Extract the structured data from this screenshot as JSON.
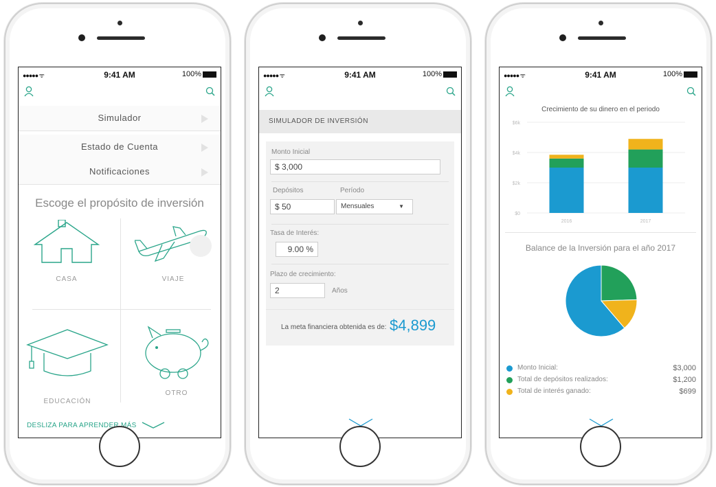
{
  "status": {
    "carrier": "●●●●● ᯤ",
    "time": "9:41 AM",
    "battery": "100%"
  },
  "screen1": {
    "menu": [
      {
        "label": "Simulador"
      },
      {
        "label": "Estado de Cuenta"
      },
      {
        "label": "Notificaciones"
      }
    ],
    "purpose_title": "Escoge el propósito de inversión",
    "options": [
      {
        "label": "CASA",
        "icon": "house-icon"
      },
      {
        "label": "VIAJE",
        "icon": "airplane-icon"
      },
      {
        "label": "EDUCACIÓN",
        "icon": "graduation-cap-icon"
      },
      {
        "label": "OTRO",
        "icon": "piggy-bank-icon"
      }
    ],
    "swipe_label": "DESLIZA PARA APRENDER MÁS"
  },
  "screen2": {
    "header": "SIMULADOR DE INVERSIÓN",
    "monto_label": "Monto Inicial",
    "monto_value": "$  3,000",
    "depositos_label": "Depósitos",
    "depositos_value": "$  50",
    "periodo_label": "Período",
    "periodo_value": "Mensuales",
    "tasa_label": "Tasa de Interés:",
    "tasa_value": "9.00  %",
    "plazo_label": "Plazo de crecimiento:",
    "plazo_value": "2",
    "plazo_unit": "Años",
    "result_label": "La meta financiera obtenida es de:",
    "result_value": "$4,899"
  },
  "screen3": {
    "legend": [
      {
        "name": "Monto Inicial:",
        "value": "$3,000",
        "color": "#1b9ad0"
      },
      {
        "name": "Total de depósitos realizados:",
        "value": "$1,200",
        "color": "#22a05a"
      },
      {
        "name": "Total de interés ganado:",
        "value": "$699",
        "color": "#f0b31c"
      }
    ]
  },
  "chart_data": [
    {
      "type": "bar",
      "stacked": true,
      "title": "Crecimiento de su dinero en el periodo",
      "categories": [
        "2016",
        "2017"
      ],
      "ytick_labels": [
        "$0",
        "$2k",
        "$4k",
        "$6k"
      ],
      "ylim": [
        0,
        6000
      ],
      "series": [
        {
          "values": [
            3000,
            3000
          ],
          "color": "#1b9ad0"
        },
        {
          "values": [
            600,
            1200
          ],
          "color": "#22a05a"
        },
        {
          "values": [
            250,
            699
          ],
          "color": "#f0b31c"
        }
      ]
    },
    {
      "type": "pie",
      "title": "Balance de la Inversión para el año 2017",
      "labels": [
        "Monto Inicial:",
        "Total de depósitos realizados:",
        "Total de interés ganado:"
      ],
      "values": [
        3000,
        1200,
        699
      ],
      "colors": [
        "#1b9ad0",
        "#22a05a",
        "#f0b31c"
      ]
    }
  ]
}
